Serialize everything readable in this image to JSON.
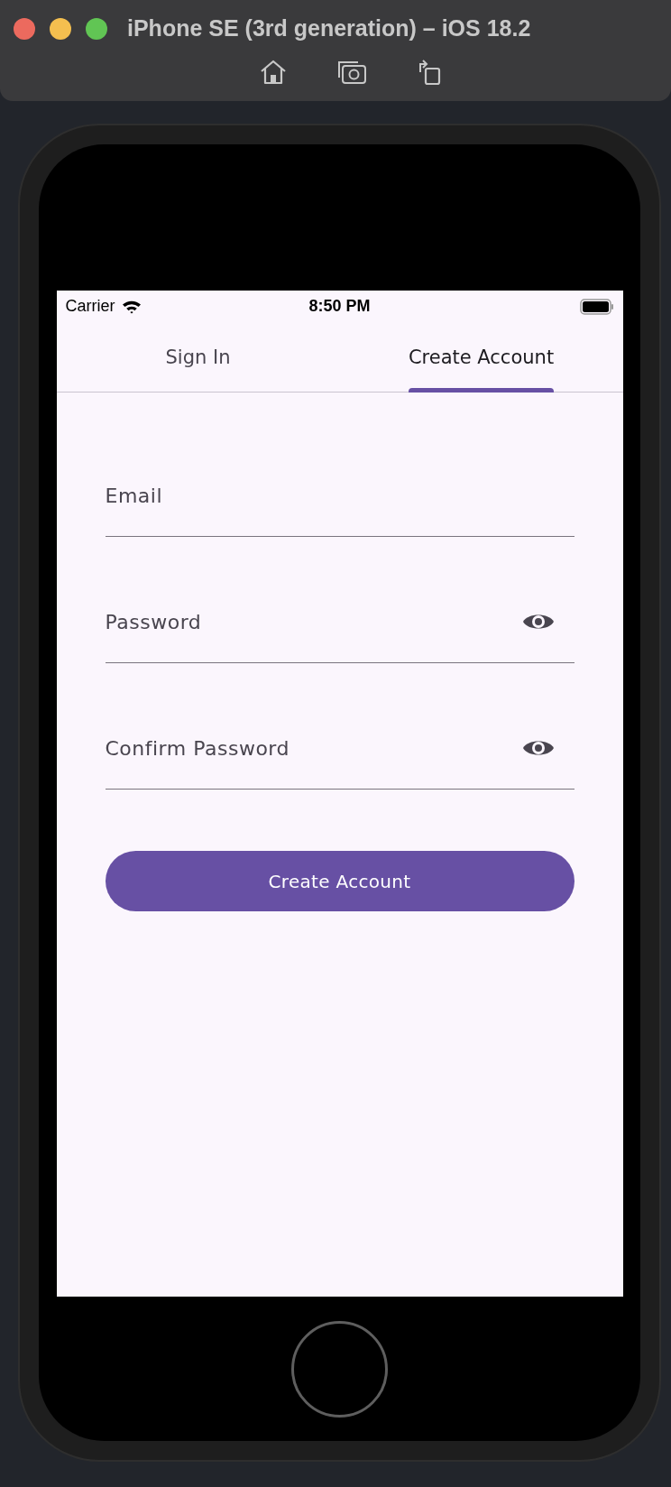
{
  "window": {
    "title": "iPhone SE (3rd generation) – iOS 18.2"
  },
  "status_bar": {
    "carrier": "Carrier",
    "time": "8:50 PM"
  },
  "tabs": [
    {
      "label": "Sign In",
      "selected": false
    },
    {
      "label": "Create Account",
      "selected": true
    }
  ],
  "fields": [
    {
      "kind": "text",
      "placeholder": "Email"
    },
    {
      "kind": "password",
      "placeholder": "Password"
    },
    {
      "kind": "password",
      "placeholder": "Confirm Password"
    }
  ],
  "submit_button": {
    "label": "Create Account"
  }
}
